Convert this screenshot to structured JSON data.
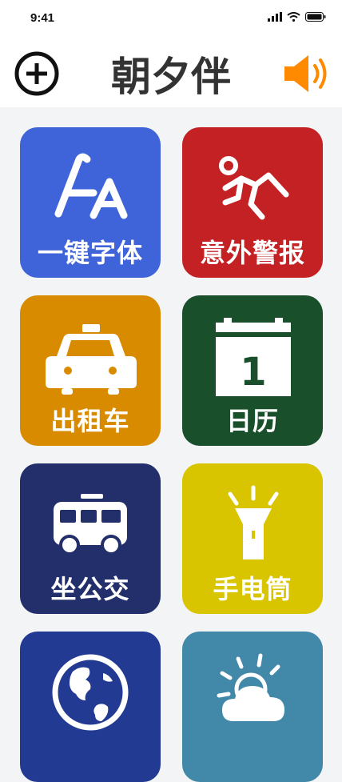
{
  "status_bar": {
    "time": "9:41"
  },
  "header": {
    "title": "朝夕伴"
  },
  "tiles": [
    {
      "label": "一键字体",
      "color": "#3f63d8",
      "icon": "font-size-icon"
    },
    {
      "label": "意外警报",
      "color": "#c32123",
      "icon": "fall-alert-icon"
    },
    {
      "label": "出租车",
      "color": "#d98b00",
      "icon": "taxi-icon"
    },
    {
      "label": "日历",
      "color": "#1a4f2b",
      "icon": "calendar-icon"
    },
    {
      "label": "坐公交",
      "color": "#232f6b",
      "icon": "bus-icon"
    },
    {
      "label": "手电筒",
      "color": "#d9c400",
      "icon": "flashlight-icon"
    },
    {
      "label": "",
      "color": "#233a93",
      "icon": "globe-icon"
    },
    {
      "label": "",
      "color": "#4288a8",
      "icon": "weather-icon"
    }
  ],
  "calendar_day": "1",
  "colors": {
    "speaker": "#ff8a00",
    "title": "#333333",
    "background": "#f2f4f6"
  }
}
